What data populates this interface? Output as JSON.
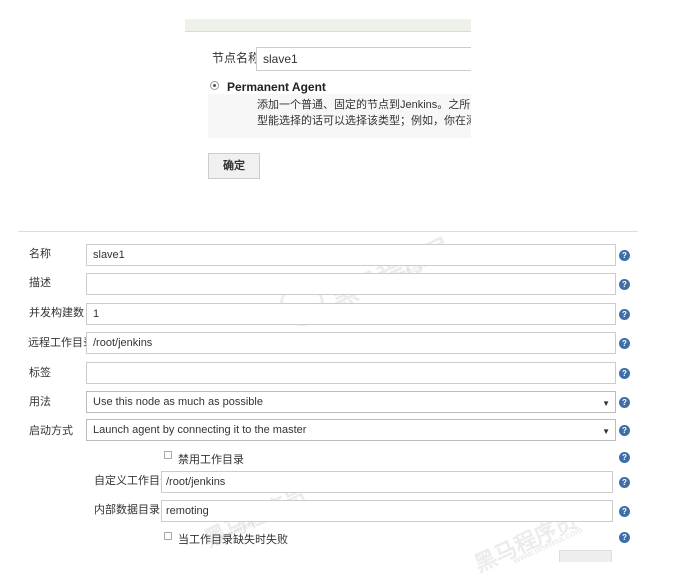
{
  "new_node_panel": {
    "node_name_label": "节点名称",
    "node_name_value": "slave1",
    "agent_type_label": "Permanent Agent",
    "agent_type_description_line1": "添加一个普通、固定的节点到Jenkins。之所以叫",
    "agent_type_description_line2": "型能选择的话可以选择该类型；例如，你在添加",
    "ok_button": "确定"
  },
  "node_form": {
    "name": {
      "label": "名称",
      "value": "slave1"
    },
    "description": {
      "label": "描述",
      "value": ""
    },
    "executors": {
      "label": "并发构建数",
      "value": "1"
    },
    "remote_root": {
      "label": "远程工作目录",
      "value": "/root/jenkins"
    },
    "labels": {
      "label": "标签",
      "value": ""
    },
    "usage": {
      "label": "用法",
      "selected": "Use this node as much as possible"
    },
    "launch_method": {
      "label": "启动方式",
      "selected": "Launch agent by connecting it to the master"
    },
    "disable_workdir": {
      "label": "禁用工作目录",
      "checked": false
    },
    "custom_workdir": {
      "label": "自定义工作目录",
      "value": "/root/jenkins"
    },
    "internal_data_dir": {
      "label": "内部数据目录",
      "value": "remoting"
    },
    "fail_if_workdir_missing": {
      "label": "当工作目录缺失时失败",
      "checked": false
    },
    "help_icon_glyph": "?"
  },
  "watermark": {
    "brand": "黑马程序员",
    "site": "www.itheima.com"
  }
}
